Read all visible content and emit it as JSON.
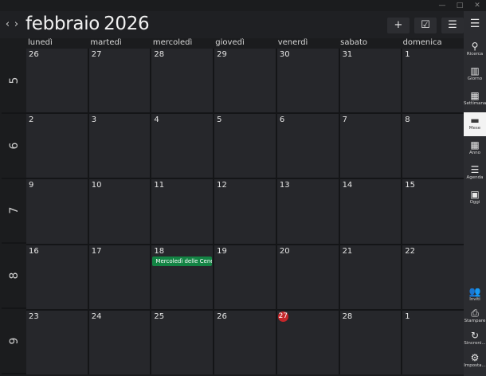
{
  "header": {
    "prev_label": "‹",
    "next_label": "›",
    "month": "febbraio",
    "year": "2026",
    "add_label": "+",
    "tasks_label": "☑",
    "filter_label": "☰"
  },
  "window": {
    "minimize": "—",
    "maximize": "□",
    "close": "✕"
  },
  "weekdays": [
    "lunedì",
    "martedì",
    "mercoledì",
    "giovedì",
    "venerdì",
    "sabato",
    "domenica"
  ],
  "weeks": [
    {
      "number": "5",
      "days": [
        "26",
        "27",
        "28",
        "29",
        "30",
        "31",
        "1"
      ]
    },
    {
      "number": "6",
      "days": [
        "2",
        "3",
        "4",
        "5",
        "6",
        "7",
        "8"
      ]
    },
    {
      "number": "7",
      "days": [
        "9",
        "10",
        "11",
        "12",
        "13",
        "14",
        "15"
      ]
    },
    {
      "number": "8",
      "days": [
        "16",
        "17",
        "18",
        "19",
        "20",
        "21",
        "22"
      ]
    },
    {
      "number": "9",
      "days": [
        "23",
        "24",
        "25",
        "26",
        "27",
        "28",
        "1"
      ]
    }
  ],
  "event": {
    "title": "Mercoledì delle Ceneri",
    "color": "#138444"
  },
  "today_color": "#c5262a",
  "sidebar": {
    "menu_icon": "hamburger-icon",
    "items": [
      {
        "label": "Ricerca",
        "icon": "search-icon",
        "glyph": "⚲"
      },
      {
        "label": "Giorno",
        "icon": "day-view-icon",
        "glyph": "▥"
      },
      {
        "label": "Settimana",
        "icon": "week-view-icon",
        "glyph": "▦"
      },
      {
        "label": "Mese",
        "icon": "month-view-icon",
        "glyph": "▬"
      },
      {
        "label": "Anno",
        "icon": "year-view-icon",
        "glyph": "▦"
      },
      {
        "label": "Agenda",
        "icon": "agenda-icon",
        "glyph": "☰"
      },
      {
        "label": "Oggi",
        "icon": "today-icon",
        "glyph": "▣"
      },
      {
        "label": "Inviti",
        "icon": "invites-icon",
        "glyph": "👥"
      },
      {
        "label": "Stampare",
        "icon": "print-icon",
        "glyph": "⎙"
      },
      {
        "label": "Sincroni...",
        "icon": "sync-icon",
        "glyph": "↻"
      },
      {
        "label": "Imposta...",
        "icon": "settings-icon",
        "glyph": "⚙"
      }
    ]
  }
}
